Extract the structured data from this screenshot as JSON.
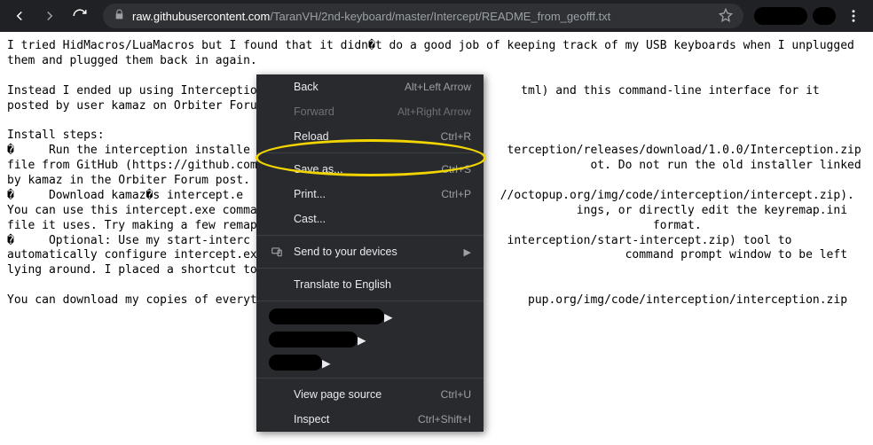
{
  "browser": {
    "url_domain": "raw.githubusercontent.com",
    "url_path": "/TaranVH/2nd-keyboard/master/Intercept/README_from_geofff.txt"
  },
  "content": {
    "text": "I tried HidMacros/LuaMacros but I found that it didn�t do a good job of keeping track of my USB keyboards when I unplugged them and plugged them back in again.\n\nInstead I ended up using Interception                                     tml) and this command-line interface for it posted by user kamaz on Orbiter Forum (http://orbite                                     \n\nInstall steps:\n�     Run the interception installe                                     terception/releases/download/1.0.0/Interception.zip file from GitHub (https://github.com/oblitum/In                                     ot. Do not run the old installer linked by kamaz in the Orbiter Forum post.\n�     Download kamaz�s intercept.e                                     //octopup.org/img/code/interception/intercept.zip). You can use this intercept.exe command-line t                                     ings, or directly edit the keyremap.ini file it uses. Try making a few remappings and save them                                      format.\n�     Optional: Use my start-interc                                     interception/start-intercept.zip) tool to automatically configure intercept.exe to run when y                                      command prompt window to be left lying around. I placed a shortcut to start-intercept.vbs in my \n\nYou can download my copies of everythi                                     pup.org/img/code/interception/interception.zip"
  },
  "menu": {
    "back": {
      "label": "Back",
      "shortcut": "Alt+Left Arrow"
    },
    "forward": {
      "label": "Forward",
      "shortcut": "Alt+Right Arrow"
    },
    "reload": {
      "label": "Reload",
      "shortcut": "Ctrl+R"
    },
    "saveas": {
      "label": "Save as...",
      "shortcut": "Ctrl+S"
    },
    "print": {
      "label": "Print...",
      "shortcut": "Ctrl+P"
    },
    "cast": {
      "label": "Cast..."
    },
    "send": {
      "label": "Send to your devices"
    },
    "translate": {
      "label": "Translate to English"
    },
    "viewsource": {
      "label": "View page source",
      "shortcut": "Ctrl+U"
    },
    "inspect": {
      "label": "Inspect",
      "shortcut": "Ctrl+Shift+I"
    }
  }
}
